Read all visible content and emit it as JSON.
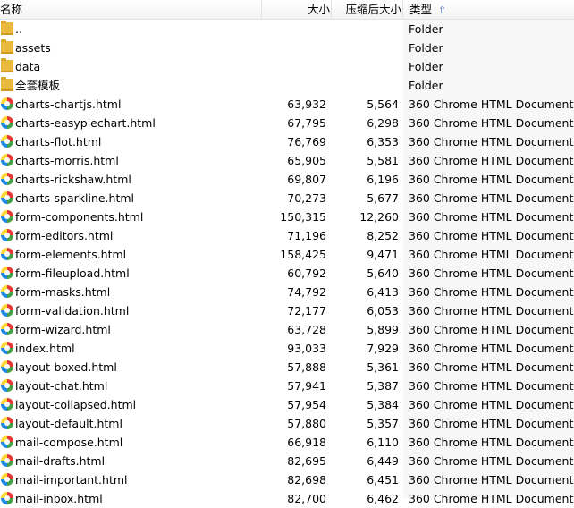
{
  "columns": {
    "name": "名称",
    "size": "大小",
    "compressed": "压缩后大小",
    "type": "类型"
  },
  "rows": [
    {
      "name": "..",
      "size": "",
      "compressed": "",
      "type": "Folder",
      "icon": "folder-icon"
    },
    {
      "name": "assets",
      "size": "",
      "compressed": "",
      "type": "Folder",
      "icon": "folder-icon"
    },
    {
      "name": "data",
      "size": "",
      "compressed": "",
      "type": "Folder",
      "icon": "folder-icon"
    },
    {
      "name": "全套模板",
      "size": "",
      "compressed": "",
      "type": "Folder",
      "icon": "folder-icon"
    },
    {
      "name": "charts-chartjs.html",
      "size": "63,932",
      "compressed": "5,564",
      "type": "360 Chrome HTML Document",
      "icon": "html-file-icon"
    },
    {
      "name": "charts-easypiechart.html",
      "size": "67,795",
      "compressed": "6,298",
      "type": "360 Chrome HTML Document",
      "icon": "html-file-icon"
    },
    {
      "name": "charts-flot.html",
      "size": "76,769",
      "compressed": "6,353",
      "type": "360 Chrome HTML Document",
      "icon": "html-file-icon"
    },
    {
      "name": "charts-morris.html",
      "size": "65,905",
      "compressed": "5,581",
      "type": "360 Chrome HTML Document",
      "icon": "html-file-icon"
    },
    {
      "name": "charts-rickshaw.html",
      "size": "69,807",
      "compressed": "6,196",
      "type": "360 Chrome HTML Document",
      "icon": "html-file-icon"
    },
    {
      "name": "charts-sparkline.html",
      "size": "70,273",
      "compressed": "5,677",
      "type": "360 Chrome HTML Document",
      "icon": "html-file-icon"
    },
    {
      "name": "form-components.html",
      "size": "150,315",
      "compressed": "12,260",
      "type": "360 Chrome HTML Document",
      "icon": "html-file-icon"
    },
    {
      "name": "form-editors.html",
      "size": "71,196",
      "compressed": "8,252",
      "type": "360 Chrome HTML Document",
      "icon": "html-file-icon"
    },
    {
      "name": "form-elements.html",
      "size": "158,425",
      "compressed": "9,471",
      "type": "360 Chrome HTML Document",
      "icon": "html-file-icon"
    },
    {
      "name": "form-fileupload.html",
      "size": "60,792",
      "compressed": "5,640",
      "type": "360 Chrome HTML Document",
      "icon": "html-file-icon"
    },
    {
      "name": "form-masks.html",
      "size": "74,792",
      "compressed": "6,413",
      "type": "360 Chrome HTML Document",
      "icon": "html-file-icon"
    },
    {
      "name": "form-validation.html",
      "size": "72,177",
      "compressed": "6,053",
      "type": "360 Chrome HTML Document",
      "icon": "html-file-icon"
    },
    {
      "name": "form-wizard.html",
      "size": "63,728",
      "compressed": "5,899",
      "type": "360 Chrome HTML Document",
      "icon": "html-file-icon"
    },
    {
      "name": "index.html",
      "size": "93,033",
      "compressed": "7,929",
      "type": "360 Chrome HTML Document",
      "icon": "html-file-icon"
    },
    {
      "name": "layout-boxed.html",
      "size": "57,888",
      "compressed": "5,361",
      "type": "360 Chrome HTML Document",
      "icon": "html-file-icon"
    },
    {
      "name": "layout-chat.html",
      "size": "57,941",
      "compressed": "5,387",
      "type": "360 Chrome HTML Document",
      "icon": "html-file-icon"
    },
    {
      "name": "layout-collapsed.html",
      "size": "57,954",
      "compressed": "5,384",
      "type": "360 Chrome HTML Document",
      "icon": "html-file-icon"
    },
    {
      "name": "layout-default.html",
      "size": "57,880",
      "compressed": "5,357",
      "type": "360 Chrome HTML Document",
      "icon": "html-file-icon"
    },
    {
      "name": "mail-compose.html",
      "size": "66,918",
      "compressed": "6,110",
      "type": "360 Chrome HTML Document",
      "icon": "html-file-icon"
    },
    {
      "name": "mail-drafts.html",
      "size": "82,695",
      "compressed": "6,449",
      "type": "360 Chrome HTML Document",
      "icon": "html-file-icon"
    },
    {
      "name": "mail-important.html",
      "size": "82,698",
      "compressed": "6,451",
      "type": "360 Chrome HTML Document",
      "icon": "html-file-icon"
    },
    {
      "name": "mail-inbox.html",
      "size": "82,700",
      "compressed": "6,462",
      "type": "360 Chrome HTML Document",
      "icon": "html-file-icon"
    }
  ]
}
